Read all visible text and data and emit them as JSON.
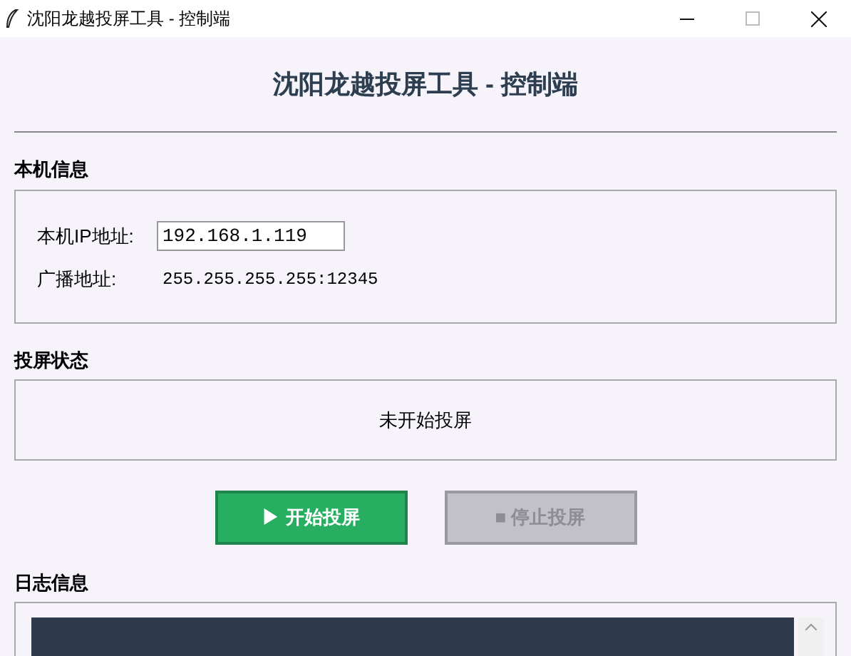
{
  "window": {
    "title": "沈阳龙越投屏工具 - 控制端"
  },
  "heading": "沈阳龙越投屏工具 - 控制端",
  "local_info": {
    "title": "本机信息",
    "ip_label": "本机IP地址:",
    "ip_value": "192.168.1.119",
    "broadcast_label": "广播地址:",
    "broadcast_value": "255.255.255.255:12345"
  },
  "status": {
    "title": "投屏状态",
    "text": "未开始投屏"
  },
  "buttons": [
    {
      "kind": "start",
      "label": "▶ 开始投屏",
      "disabled": false
    },
    {
      "kind": "stop",
      "label": "■ 停止投屏",
      "disabled": true
    }
  ],
  "log": {
    "title": "日志信息"
  }
}
